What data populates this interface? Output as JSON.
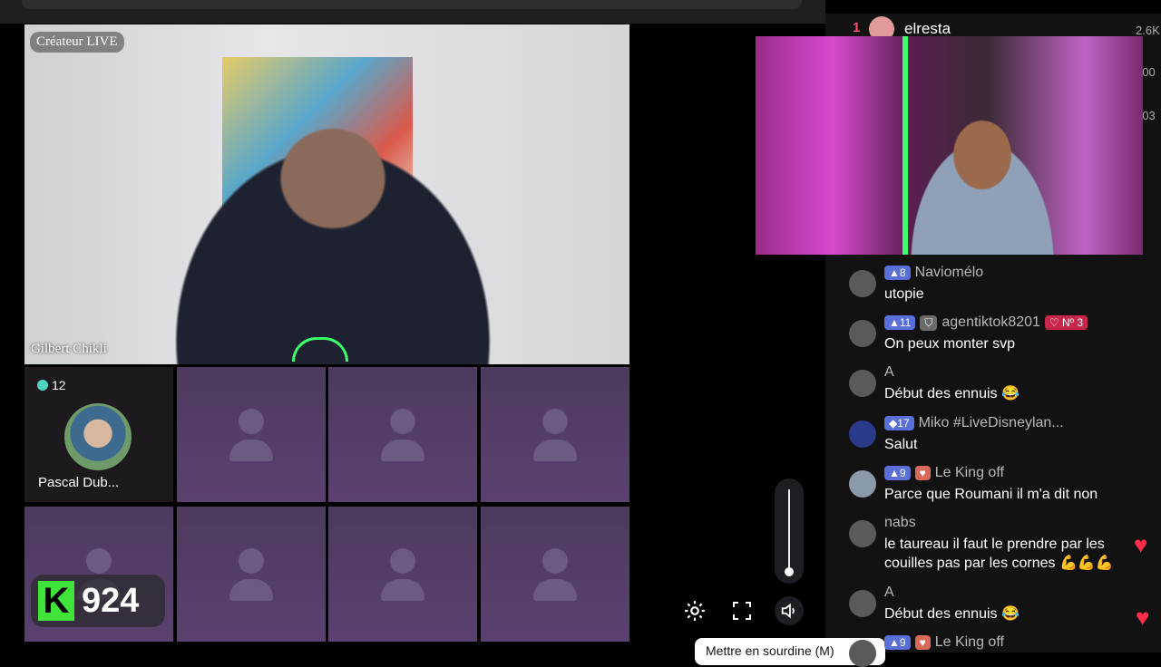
{
  "host": {
    "badge": "Créateur LIVE",
    "name": "Gilbert Chikli"
  },
  "guest": {
    "level": "12",
    "name": "Pascal Dub..."
  },
  "score": {
    "value": "924"
  },
  "tooltip": "Mettre en sourdine (M)",
  "leaderboard": {
    "rank": "1",
    "name": "elresta",
    "values": [
      "2.6K",
      "400",
      "303"
    ]
  },
  "chat": [
    {
      "badges": [
        "8"
      ],
      "name": "Naviomélo",
      "text": "utopie"
    },
    {
      "badges": [
        "11",
        "",
        "Nº 3"
      ],
      "name": "agentiktok8201",
      "text": "On peux monter svp"
    },
    {
      "badges": [],
      "name": "A",
      "text": "Début des ennuis 😂"
    },
    {
      "badges": [
        "17"
      ],
      "name": "Miko #LiveDisneylan...",
      "text": "Salut"
    },
    {
      "badges": [
        "9",
        ""
      ],
      "name": "Le King off",
      "text": "Parce que Roumani il m'a dit non"
    },
    {
      "badges": [],
      "name": "nabs",
      "text": "le taureau il faut le prendre par les couilles pas par les cornes 💪💪💪"
    },
    {
      "badges": [],
      "name": "A",
      "text": "Début des ennuis 😂"
    },
    {
      "badges": [
        "9",
        ""
      ],
      "name": "Le King off",
      "text": ""
    }
  ],
  "icons": {
    "settings": "gear-icon",
    "fullscreen": "fullscreen-icon",
    "volume": "speaker-icon",
    "heart": "heart-icon"
  }
}
